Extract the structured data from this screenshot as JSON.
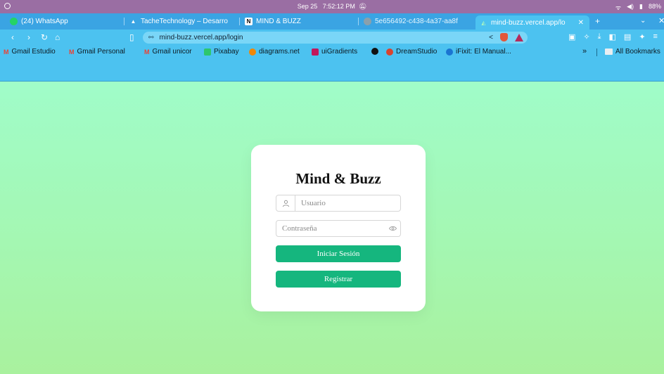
{
  "os": {
    "date": "Sep 25",
    "time": "7:52:12 PM",
    "battery": "88%"
  },
  "tabs": [
    {
      "label": "(24) WhatsApp"
    },
    {
      "label": "TacheTechnology – Desarro"
    },
    {
      "label": "MIND & BUZZ"
    },
    {
      "label": "5e656492-c438-4a37-aa8f"
    },
    {
      "label": "mind-buzz.vercel.app/lo",
      "active": true
    }
  ],
  "address": {
    "url": "mind-buzz.vercel.app/login"
  },
  "bookmarks": [
    "Gmail Estudio",
    "Gmail Personal",
    "Gmail unicor",
    "Pixabay",
    "diagrams.net",
    "uiGradients",
    "DreamStudio",
    "iFixit: El Manual..."
  ],
  "bookmarks_all": "All Bookmarks",
  "login": {
    "title": "Mind & Buzz",
    "username_placeholder": "Usuario",
    "password_placeholder": "Contraseña",
    "login_label": "Iniciar Sesión",
    "register_label": "Registrar"
  },
  "colors": {
    "primary_button": "#15b67e",
    "tabstrip": "#3aa4e3",
    "toolbar": "#4cc2f0"
  }
}
